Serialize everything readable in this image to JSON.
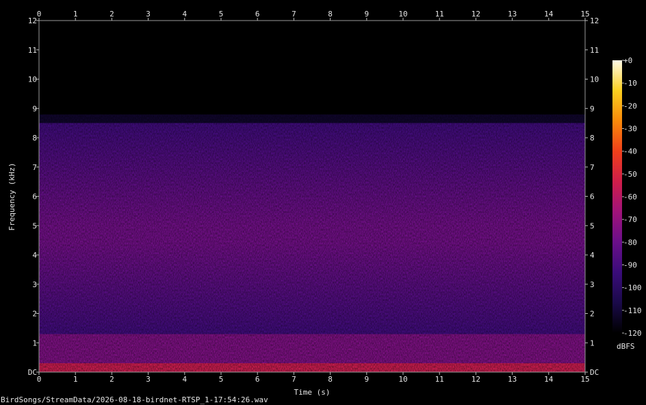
{
  "chart_data": {
    "type": "heatmap",
    "xlabel": "Time (s)",
    "ylabel": "Frequency (kHz)",
    "xlim": [
      0,
      15
    ],
    "ylim": [
      0,
      12
    ],
    "x_ticks": [
      "0",
      "1",
      "2",
      "3",
      "4",
      "5",
      "6",
      "7",
      "8",
      "9",
      "10",
      "11",
      "12",
      "13",
      "14",
      "15"
    ],
    "y_ticks": [
      "DC",
      "1",
      "2",
      "3",
      "4",
      "5",
      "6",
      "7",
      "8",
      "9",
      "10",
      "11",
      "12"
    ],
    "colorbar": {
      "label": "dBFS",
      "range": [
        -120,
        0
      ],
      "ticks": [
        "+0",
        "-10",
        "-20",
        "-30",
        "-40",
        "-50",
        "-60",
        "-70",
        "-80",
        "-90",
        "-100",
        "-110",
        "-120"
      ],
      "colors": [
        "#000000",
        "#1a0a4a",
        "#3a0c7a",
        "#6a0f8a",
        "#a0137a",
        "#d01e4a",
        "#f0401a",
        "#fa8a0a",
        "#fcd020",
        "#fffbe8"
      ]
    },
    "features": [
      {
        "kind": "band",
        "freq_khz_low": 0.0,
        "freq_khz_high": 0.3,
        "level_dbfs": -55
      },
      {
        "kind": "band",
        "freq_khz_low": 0.3,
        "freq_khz_high": 1.3,
        "level_dbfs": -75
      },
      {
        "kind": "band",
        "freq_khz_low": 4.4,
        "freq_khz_high": 5.0,
        "level_dbfs": -78
      },
      {
        "kind": "background",
        "freq_khz_low": 1.3,
        "freq_khz_high": 8.5,
        "level_dbfs": -92
      },
      {
        "kind": "rolloff",
        "freq_khz_low": 8.5,
        "freq_khz_high": 8.8,
        "level_dbfs": -112
      },
      {
        "kind": "silence",
        "freq_khz_low": 8.8,
        "freq_khz_high": 12.0,
        "level_dbfs": -120
      }
    ]
  },
  "file_path": "BirdSongs/StreamData/2026-08-18-birdnet-RTSP_1-17:54:26.wav"
}
